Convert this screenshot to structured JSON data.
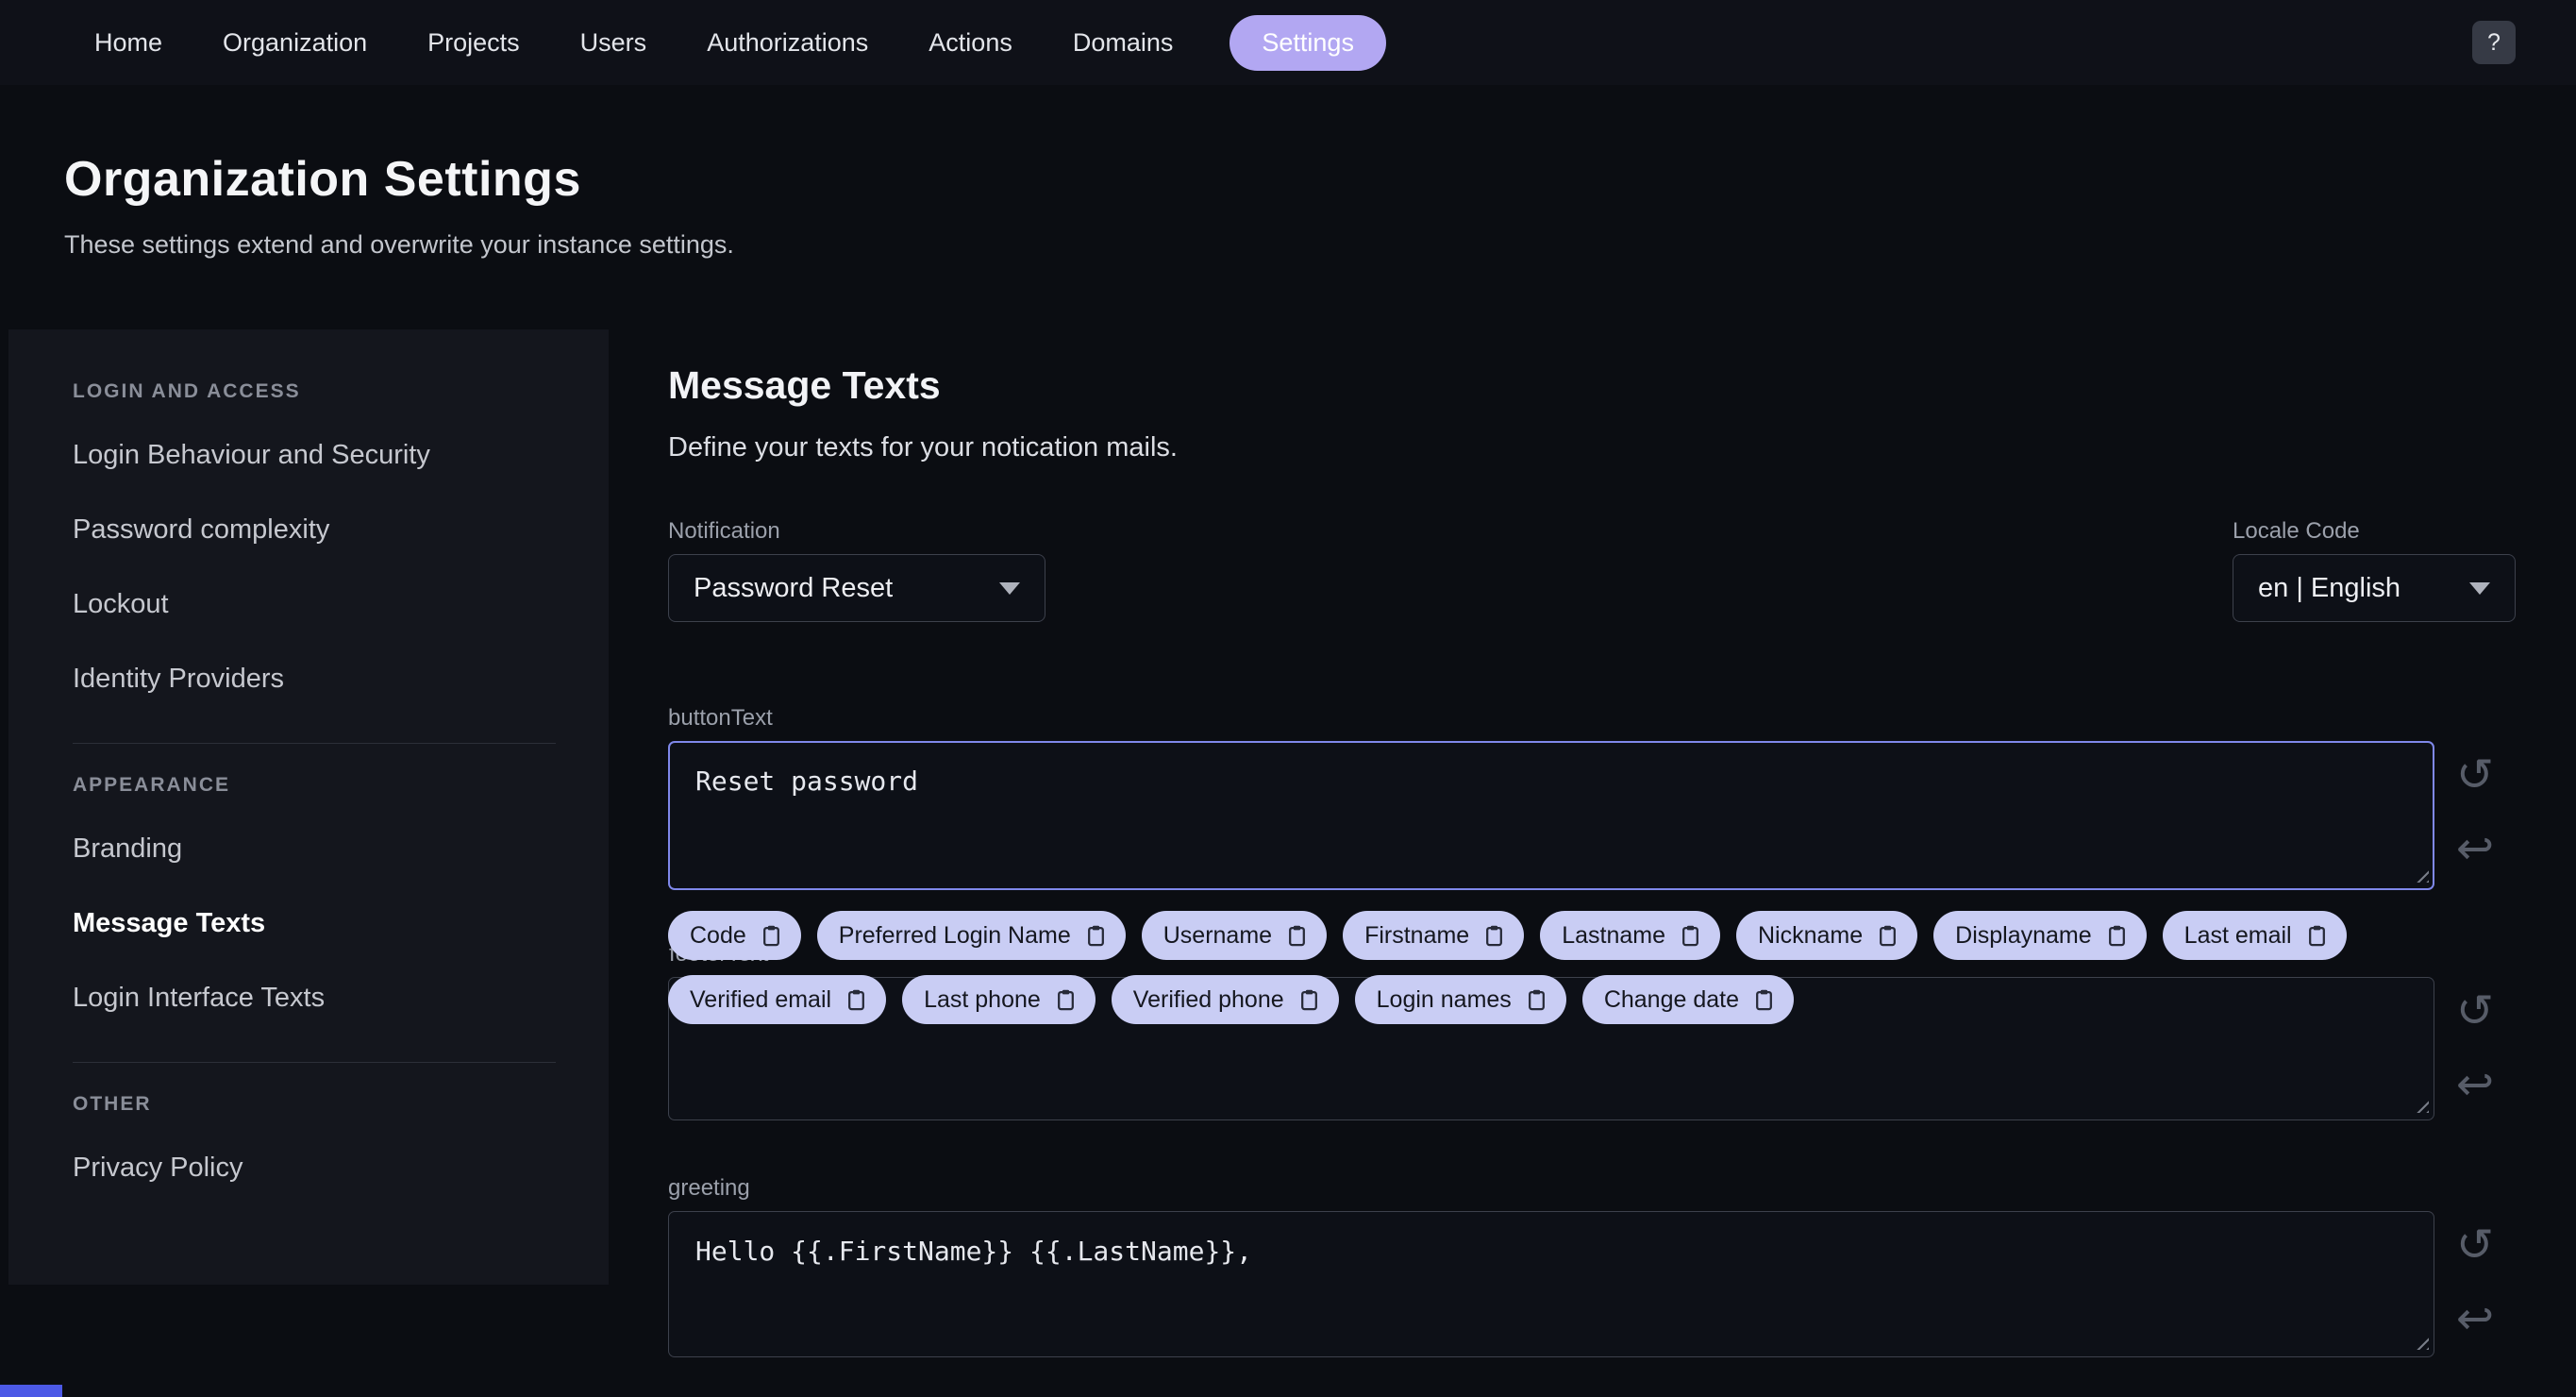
{
  "theme": {
    "accent": "#7f88ea",
    "chip_bg": "#c9cdf4",
    "active_pill_bg": "#b2a7f2"
  },
  "nav": {
    "items": [
      {
        "label": "Home",
        "active": false
      },
      {
        "label": "Organization",
        "active": false
      },
      {
        "label": "Projects",
        "active": false
      },
      {
        "label": "Users",
        "active": false
      },
      {
        "label": "Authorizations",
        "active": false
      },
      {
        "label": "Actions",
        "active": false
      },
      {
        "label": "Domains",
        "active": false
      },
      {
        "label": "Settings",
        "active": true
      }
    ],
    "help_label": "?"
  },
  "header": {
    "title": "Organization Settings",
    "subtitle": "These settings extend and overwrite your instance settings."
  },
  "sidebar": {
    "active": "Message Texts",
    "sections": [
      {
        "heading": "LOGIN AND ACCESS",
        "items": [
          "Login Behaviour and Security",
          "Password complexity",
          "Lockout",
          "Identity Providers"
        ]
      },
      {
        "heading": "APPEARANCE",
        "items": [
          "Branding",
          "Message Texts",
          "Login Interface Texts"
        ]
      },
      {
        "heading": "OTHER",
        "items": [
          "Privacy Policy"
        ]
      }
    ]
  },
  "main": {
    "title": "Message Texts",
    "subtitle": "Define your texts for your notication mails.",
    "notification": {
      "label": "Notification",
      "value": "Password Reset"
    },
    "locale": {
      "label": "Locale Code",
      "value": "en | English"
    },
    "fields": {
      "buttonText": {
        "label": "buttonText",
        "value": "Reset password"
      },
      "footerText": {
        "label": "footerText",
        "value": ""
      },
      "greeting": {
        "label": "greeting",
        "value": "Hello {{.FirstName}} {{.LastName}},"
      }
    },
    "chips": [
      "Code",
      "Preferred Login Name",
      "Username",
      "Firstname",
      "Lastname",
      "Nickname",
      "Displayname",
      "Last email",
      "Verified email",
      "Last phone",
      "Verified phone",
      "Login names",
      "Change date"
    ],
    "chips_row_split": 8
  }
}
